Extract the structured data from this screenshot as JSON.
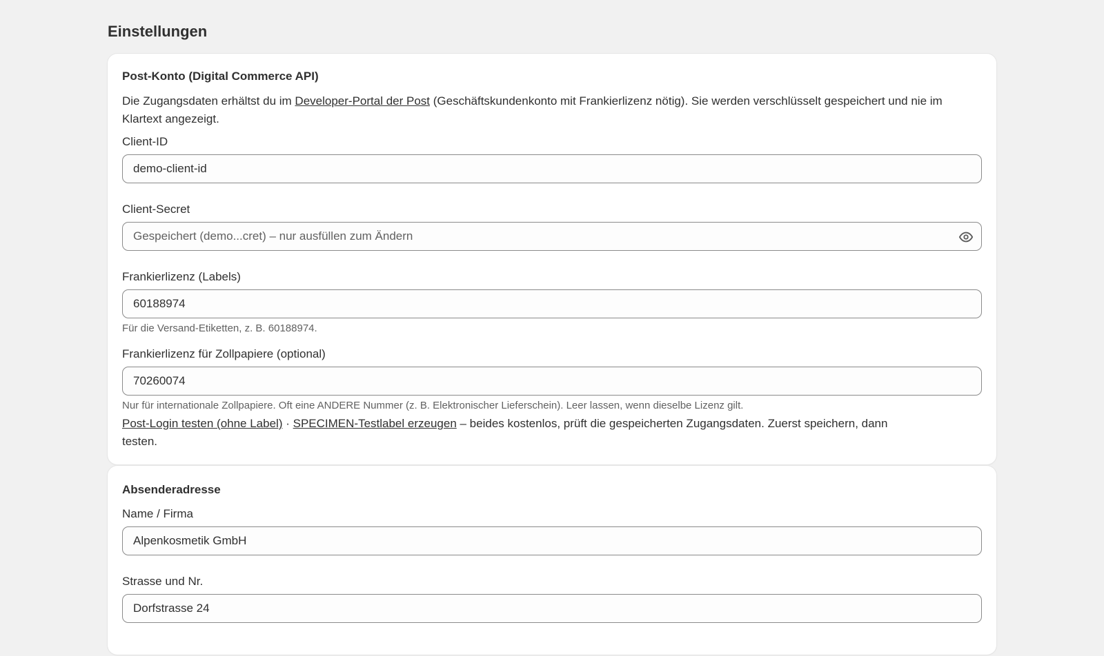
{
  "page": {
    "title": "Einstellungen"
  },
  "post_account": {
    "title": "Post-Konto (Digital Commerce API)",
    "intro_before": "Die Zugangsdaten erhältst du im ",
    "intro_link": "Developer-Portal der Post",
    "intro_after": " (Geschäftskundenkonto mit Frankierlizenz nötig). Sie werden verschlüsselt gespeichert und nie im Klartext angezeigt.",
    "client_id": {
      "label": "Client-ID",
      "value": "demo-client-id"
    },
    "client_secret": {
      "label": "Client-Secret",
      "value": "",
      "placeholder": "Gespeichert (demo...cret) – nur ausfüllen zum Ändern",
      "toggle_icon": "eye-icon"
    },
    "license_labels": {
      "label": "Frankierlizenz (Labels)",
      "value": "60188974",
      "help": "Für die Versand-Etiketten, z. B. 60188974."
    },
    "license_customs": {
      "label": "Frankierlizenz für Zollpapiere (optional)",
      "value": "70260074",
      "help": "Nur für internationale Zollpapiere. Oft eine ANDERE Nummer (z. B. Elektronischer Lieferschein). Leer lassen, wenn dieselbe Lizenz gilt."
    },
    "test_login_link": "Post-Login testen (ohne Label)",
    "separator": " · ",
    "specimen_link": "SPECIMEN-Testlabel erzeugen",
    "test_note": " – beides kostenlos, prüft die gespeicherten Zugangsdaten. Zuerst speichern, dann testen."
  },
  "sender_address": {
    "title": "Absenderadresse",
    "name": {
      "label": "Name / Firma",
      "value": "Alpenkosmetik GmbH"
    },
    "street": {
      "label": "Strasse und Nr.",
      "value": "Dorfstrasse 24"
    }
  }
}
